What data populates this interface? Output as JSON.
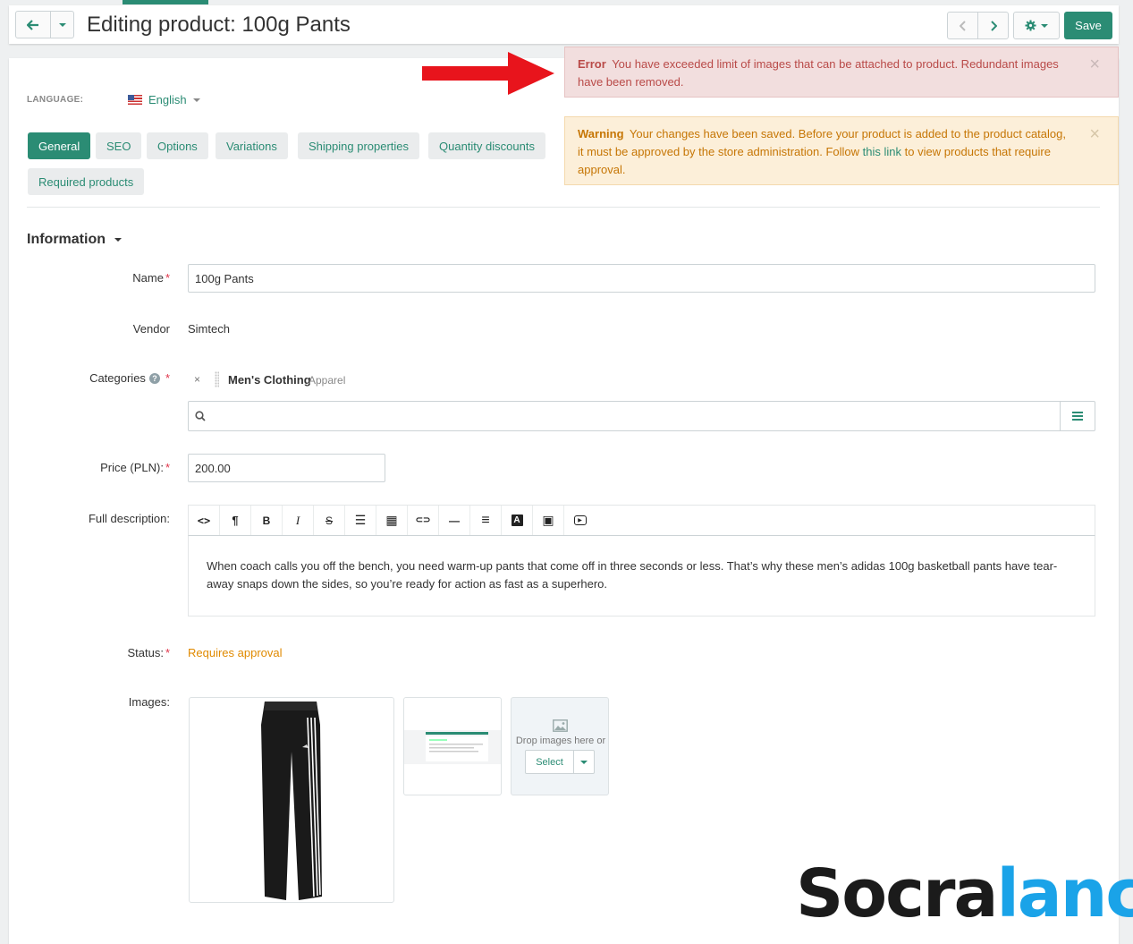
{
  "header": {
    "title": "Editing product: 100g Pants",
    "save_label": "Save"
  },
  "language": {
    "label": "LANGUAGE:",
    "value": "English"
  },
  "tabs": [
    {
      "label": "General",
      "active": true
    },
    {
      "label": "SEO"
    },
    {
      "label": "Options"
    },
    {
      "label": "Variations"
    },
    {
      "label": "Shipping properties"
    },
    {
      "label": "Quantity discounts"
    },
    {
      "label": "Required products"
    }
  ],
  "section_title": "Information",
  "fields": {
    "name_label": "Name",
    "name_value": "100g Pants",
    "vendor_label": "Vendor",
    "vendor_value": "Simtech",
    "categories_label": "Categories",
    "category_name": "Men's Clothing",
    "category_parent": "Apparel",
    "category_remove": "×",
    "price_label": "Price (PLN):",
    "price_value": "200.00",
    "description_label": "Full description:",
    "description_text": "When coach calls you off the bench, you need warm-up pants that come off in three seconds or less. That’s why these men’s adidas 100g basketball pants have tear-away snaps down the sides, so you’re ready for action as fast as a superhero.",
    "status_label": "Status:",
    "status_value": "Requires approval",
    "images_label": "Images:",
    "drop_text": "Drop images here or",
    "select_label": "Select"
  },
  "editor_toolbar": [
    {
      "icon": "code-icon",
      "glyph": "<>"
    },
    {
      "icon": "paragraph-icon",
      "glyph": "¶"
    },
    {
      "icon": "bold-icon",
      "glyph": "B"
    },
    {
      "icon": "italic-icon",
      "glyph": "I"
    },
    {
      "icon": "strikethrough-icon",
      "glyph": "S"
    },
    {
      "icon": "list-icon",
      "glyph": "☰"
    },
    {
      "icon": "table-icon",
      "glyph": "▦"
    },
    {
      "icon": "link-icon",
      "glyph": "⊂⊃"
    },
    {
      "icon": "horizontal-rule-icon",
      "glyph": "—"
    },
    {
      "icon": "align-icon",
      "glyph": "≡"
    },
    {
      "icon": "font-color-icon",
      "glyph": "A"
    },
    {
      "icon": "image-icon",
      "glyph": "▣"
    },
    {
      "icon": "video-icon",
      "glyph": "▶"
    }
  ],
  "alerts": {
    "error_title": "Error",
    "error_text": "You have exceeded limit of images that can be attached to product. Redundant images have been removed.",
    "warning_title": "Warning",
    "warning_text_before": "Your changes have been saved. Before your product is added to the product catalog, it must be approved by the store administration. Follow",
    "warning_link": "this link",
    "warning_text_after": "to view products that require approval.",
    "close": "×"
  },
  "watermark": {
    "part1": "Socra",
    "part2": "lance"
  },
  "colors": {
    "accent": "#2b8c74",
    "error_bg": "#f2dede",
    "warning_bg": "#fcefd9",
    "status": "#e08a00",
    "arrow": "#e8141c",
    "watermark_dark": "#1b1b1b",
    "watermark_blue": "#1aa3e8"
  }
}
